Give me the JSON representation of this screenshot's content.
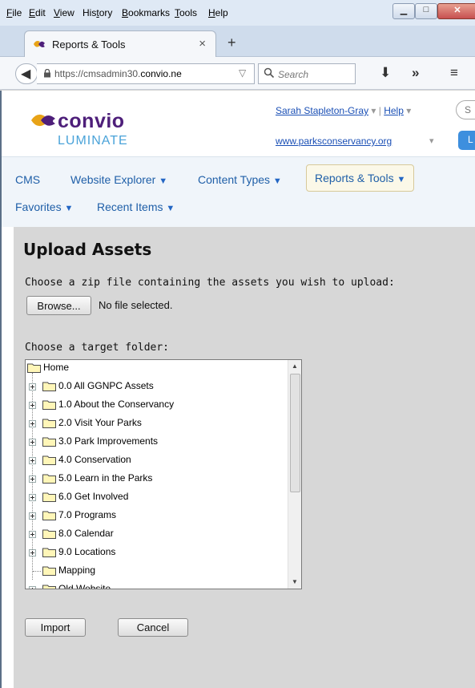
{
  "menubar": {
    "items": [
      {
        "u": "F",
        "rest": "ile"
      },
      {
        "u": "E",
        "rest": "dit"
      },
      {
        "u": "V",
        "rest": "iew"
      },
      {
        "u": "",
        "rest": "His",
        "u2": "t",
        "rest2": "ory"
      },
      {
        "u": "B",
        "rest": "ookmarks"
      },
      {
        "u": "T",
        "rest": "ools"
      },
      {
        "u": "H",
        "rest": "elp"
      }
    ]
  },
  "tab": {
    "title": "Reports & Tools",
    "close": "×",
    "new": "+"
  },
  "navbar": {
    "url_plain_1": "https://cmsadmin30.",
    "url_bold": "convio.ne",
    "search_placeholder": "Search"
  },
  "header": {
    "logo_main": "convio",
    "logo_sub": "LUMINATE",
    "user_name": "Sarah Stapleton-Gray",
    "help_link": "Help",
    "site_link": "www.parksconservancy.org",
    "search_partial": "S",
    "button_partial": "L"
  },
  "cmsnav": {
    "row1": [
      "CMS",
      "Website Explorer",
      "Content Types",
      "Reports & Tools"
    ],
    "row2": [
      "Favorites",
      "Recent Items"
    ]
  },
  "upload": {
    "heading": "Upload Assets",
    "zip_prompt": "Choose a zip file containing the assets you wish to upload:",
    "browse_label": "Browse...",
    "no_file": "No file selected.",
    "folder_prompt": "Choose a target folder:",
    "import_label": "Import",
    "cancel_label": "Cancel"
  },
  "tree": {
    "root": "Home",
    "items": [
      {
        "label": "0.0 All GGNPC Assets",
        "expandable": true
      },
      {
        "label": "1.0 About the Conservancy",
        "expandable": true
      },
      {
        "label": "2.0 Visit Your Parks",
        "expandable": true
      },
      {
        "label": "3.0 Park Improvements",
        "expandable": true
      },
      {
        "label": "4.0 Conservation",
        "expandable": true
      },
      {
        "label": "5.0 Learn in the Parks",
        "expandable": true
      },
      {
        "label": "6.0 Get Involved",
        "expandable": true
      },
      {
        "label": "7.0 Programs",
        "expandable": true
      },
      {
        "label": "8.0 Calendar",
        "expandable": true
      },
      {
        "label": "9.0 Locations",
        "expandable": true
      },
      {
        "label": "Mapping",
        "expandable": false
      },
      {
        "label": "Old Website",
        "expandable": true
      }
    ]
  },
  "colors": {
    "accent": "#1f5fa8",
    "logo_purple": "#4e1f7a",
    "logo_blue": "#4aa3d9",
    "panel_bg": "#d7d7d7"
  }
}
